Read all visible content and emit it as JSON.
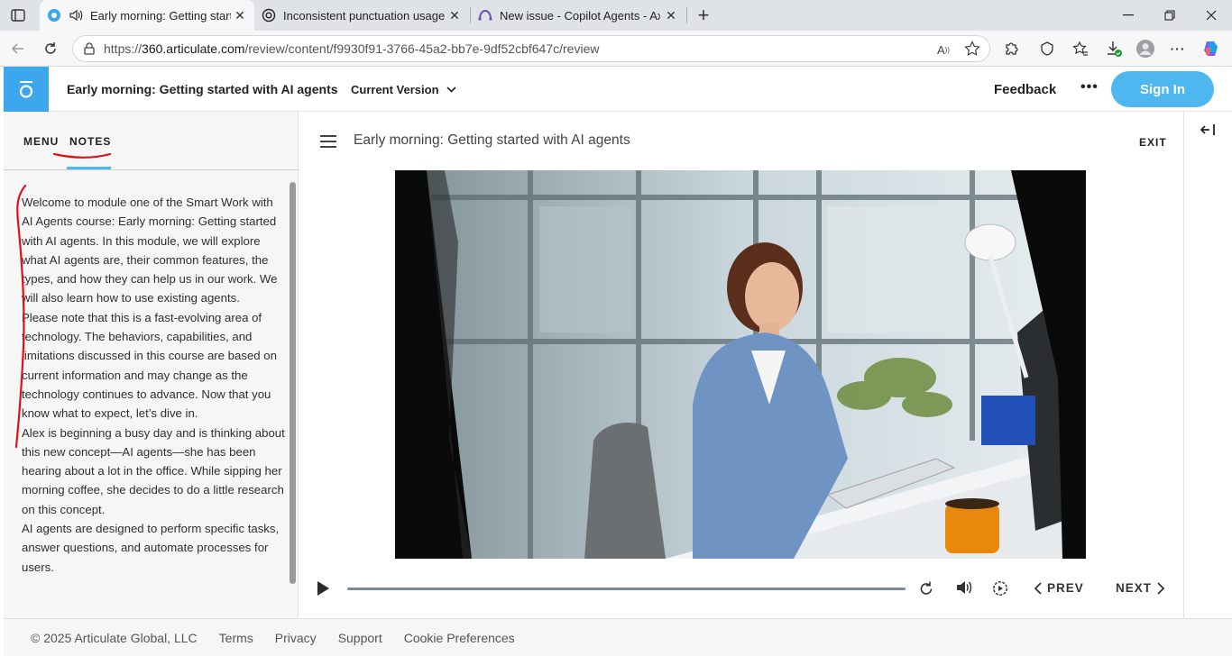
{
  "browser": {
    "tabs": [
      {
        "label": "Early morning: Getting starte",
        "favicon": "articulate-icon",
        "active": true
      },
      {
        "label": "Inconsistent punctuation usage",
        "favicon": "openai-icon",
        "active": false
      },
      {
        "label": "New issue - Copilot Agents - Axio",
        "favicon": "devops-icon",
        "active": false
      }
    ],
    "url_prefix": "https://",
    "url_domain": "360.articulate.com",
    "url_path": "/review/content/f9930f91-3766-45a2-bb7e-9df52cbf647c/review"
  },
  "header": {
    "course_title": "Early morning: Getting started with AI agents",
    "version_label": "Current Version",
    "feedback_label": "Feedback",
    "more_label": "•••",
    "signin_label": "Sign In"
  },
  "sidebar": {
    "menu_tab": "MENU",
    "notes_tab": "NOTES",
    "notes_paragraphs": [
      "Welcome to module one of the Smart Work with AI Agents course: Early morning: Getting started with AI agents. In this module, we will explore what AI agents are, their common features, the types, and how they can help us in our work. We will also learn how to use existing agents.",
      "Please note that this is a fast-evolving area of technology. The behaviors, capabilities, and limitations discussed in this course are based on current information and may change as the technology continues to advance. Now that you know what to expect, let’s dive in.",
      "Alex is beginning a busy day and is thinking about this new concept—AI agents—she has been hearing about a lot in the office. While sipping her morning coffee, she decides to do a little research on this concept.",
      "AI agents are designed to perform specific tasks, answer questions, and automate processes for users."
    ]
  },
  "player": {
    "slide_title": "Early morning: Getting started with AI agents",
    "exit_label": "EXIT",
    "prev_label": "PREV",
    "next_label": "NEXT",
    "progress": 0.0
  },
  "footer": {
    "copyright": "© 2025 Articulate Global, LLC",
    "links": [
      "Terms",
      "Privacy",
      "Support",
      "Cookie Preferences"
    ]
  },
  "colors": {
    "accent": "#4fb7ef",
    "logo_bg": "#3ca7ec",
    "annotation": "#e0101a"
  }
}
